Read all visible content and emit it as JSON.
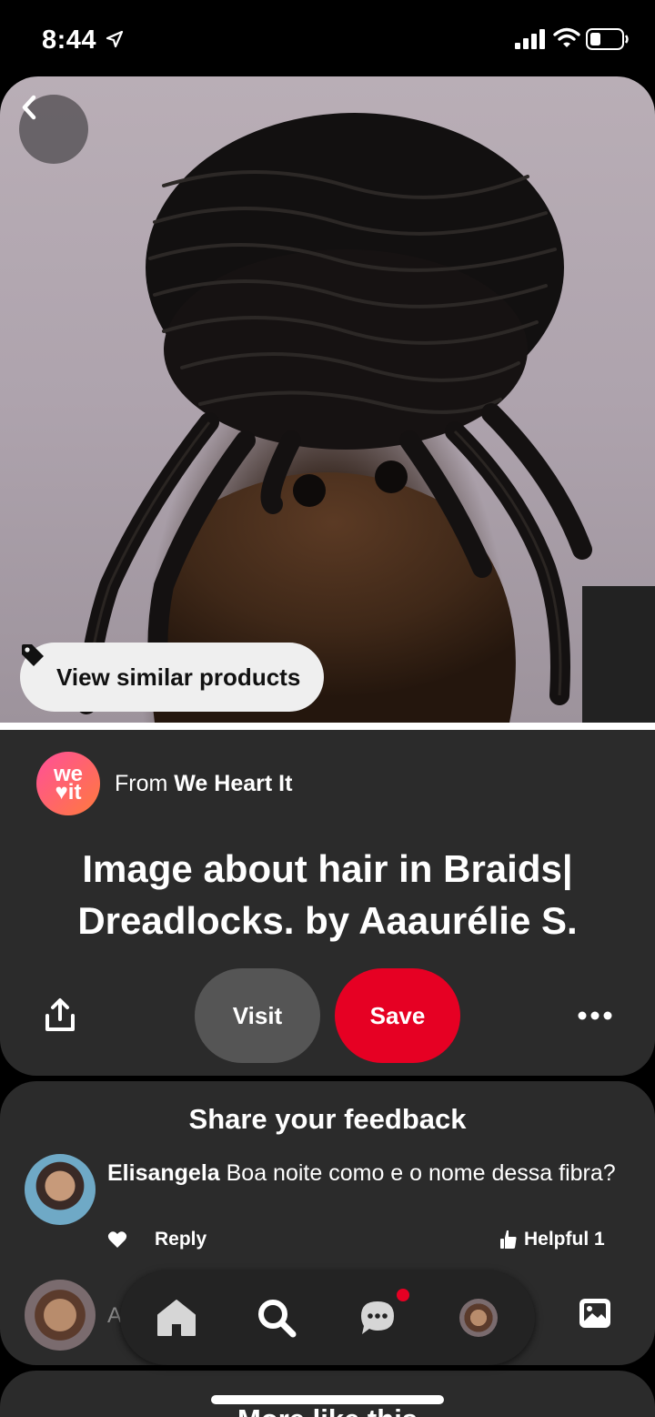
{
  "status_bar": {
    "time": "8:44"
  },
  "hero": {
    "similar_products_label": "View similar products"
  },
  "pin": {
    "source_prefix": "From",
    "source_name": "We Heart It",
    "source_logo_top": "we",
    "source_logo_bottom": "♥it",
    "title": "Image about hair in Braids| Dreadlocks. by Aaaurélie S.",
    "visit_label": "Visit",
    "save_label": "Save",
    "save_color": "#e60023"
  },
  "feedback": {
    "title": "Share your feedback",
    "comment": {
      "author": "Elisangela",
      "text": "Boa noite como e o nome dessa fibra?",
      "reply_label": "Reply",
      "helpful_label": "Helpful 1"
    },
    "add_comment_placeholder": "A"
  },
  "nav": {
    "items": [
      "home-icon",
      "search-icon",
      "messages-icon",
      "profile-avatar"
    ],
    "notification_color": "#e60023"
  },
  "more_like_this": {
    "title": "More like this"
  }
}
